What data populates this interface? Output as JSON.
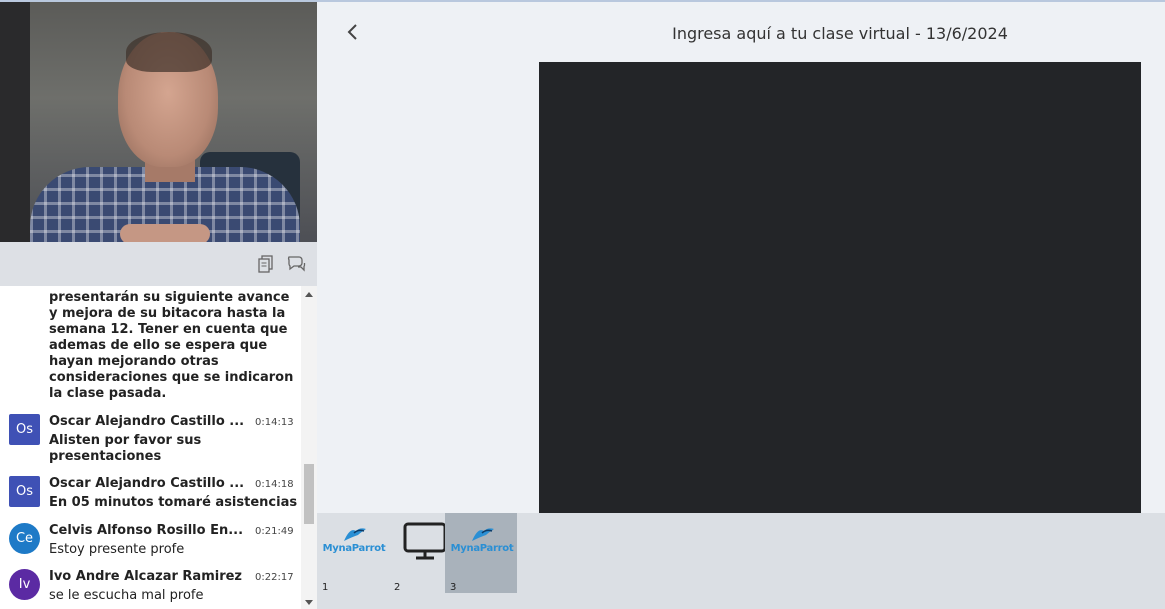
{
  "header": {
    "title": "Ingresa aquí a tu clase virtual - 13/6/2024"
  },
  "icons": {
    "back": "chevron-left-icon",
    "copy": "copy-icon",
    "chat": "chat-bubbles-icon"
  },
  "chat": {
    "previous_message": "presentarán su siguiente avance y mejora de su bitacora hasta la semana 12. Tener en cuenta que ademas de ello se espera que hayan mejorando otras consideraciones que se indicaron la clase pasada.",
    "messages": [
      {
        "initials": "Os",
        "name": "Oscar Alejandro Castillo ...",
        "time": "0:14:13",
        "text": "Alisten por favor sus presentaciones",
        "avatar_color": "#3f51b5"
      },
      {
        "initials": "Os",
        "name": "Oscar Alejandro Castillo ...",
        "time": "0:14:18",
        "text": "En 05 minutos tomaré asistencias",
        "avatar_color": "#3f51b5"
      },
      {
        "initials": "Ce",
        "name": "Celvis Alfonso Rosillo En...",
        "time": "0:21:49",
        "text": "Estoy presente profe",
        "avatar_color": "#1e7ac7"
      },
      {
        "initials": "Iv",
        "name": "Ivo Andre Alcazar Ramirez",
        "time": "0:22:17",
        "text": "se le escucha mal profe",
        "avatar_color": "#5b2aa3"
      }
    ]
  },
  "slides": [
    {
      "number": "1",
      "logo_text": "MynaParrot"
    },
    {
      "number": "2"
    },
    {
      "number": "3",
      "logo_text": "MynaParrot"
    }
  ]
}
